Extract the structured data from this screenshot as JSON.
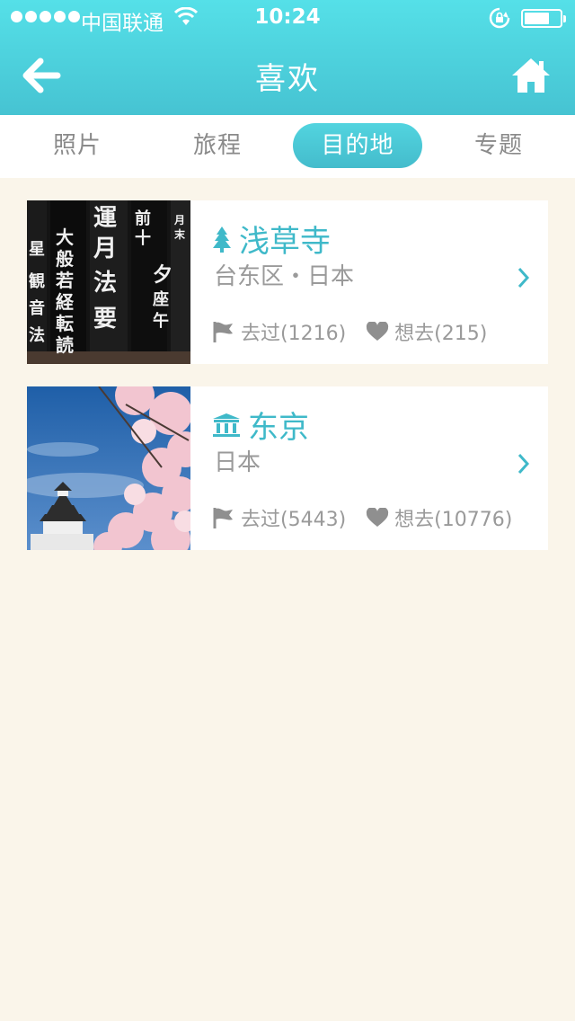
{
  "status_bar": {
    "carrier": "中国联通",
    "time": "10:24",
    "battery_level": 0.6
  },
  "nav": {
    "title": "喜欢"
  },
  "tabs": [
    {
      "label": "照片",
      "active": false
    },
    {
      "label": "旅程",
      "active": false
    },
    {
      "label": "目的地",
      "active": true
    },
    {
      "label": "专题",
      "active": false
    }
  ],
  "destinations": [
    {
      "name": "浅草寺",
      "location": "台东区・日本",
      "icon": "tree-icon",
      "visited": "去过(1216)",
      "wanted": "想去(215)"
    },
    {
      "name": "东京",
      "location": "日本",
      "icon": "landmark-icon",
      "visited": "去过(5443)",
      "wanted": "想去(10776)"
    }
  ],
  "colors": {
    "accent": "#46c3d2",
    "background": "#faf5ea"
  }
}
